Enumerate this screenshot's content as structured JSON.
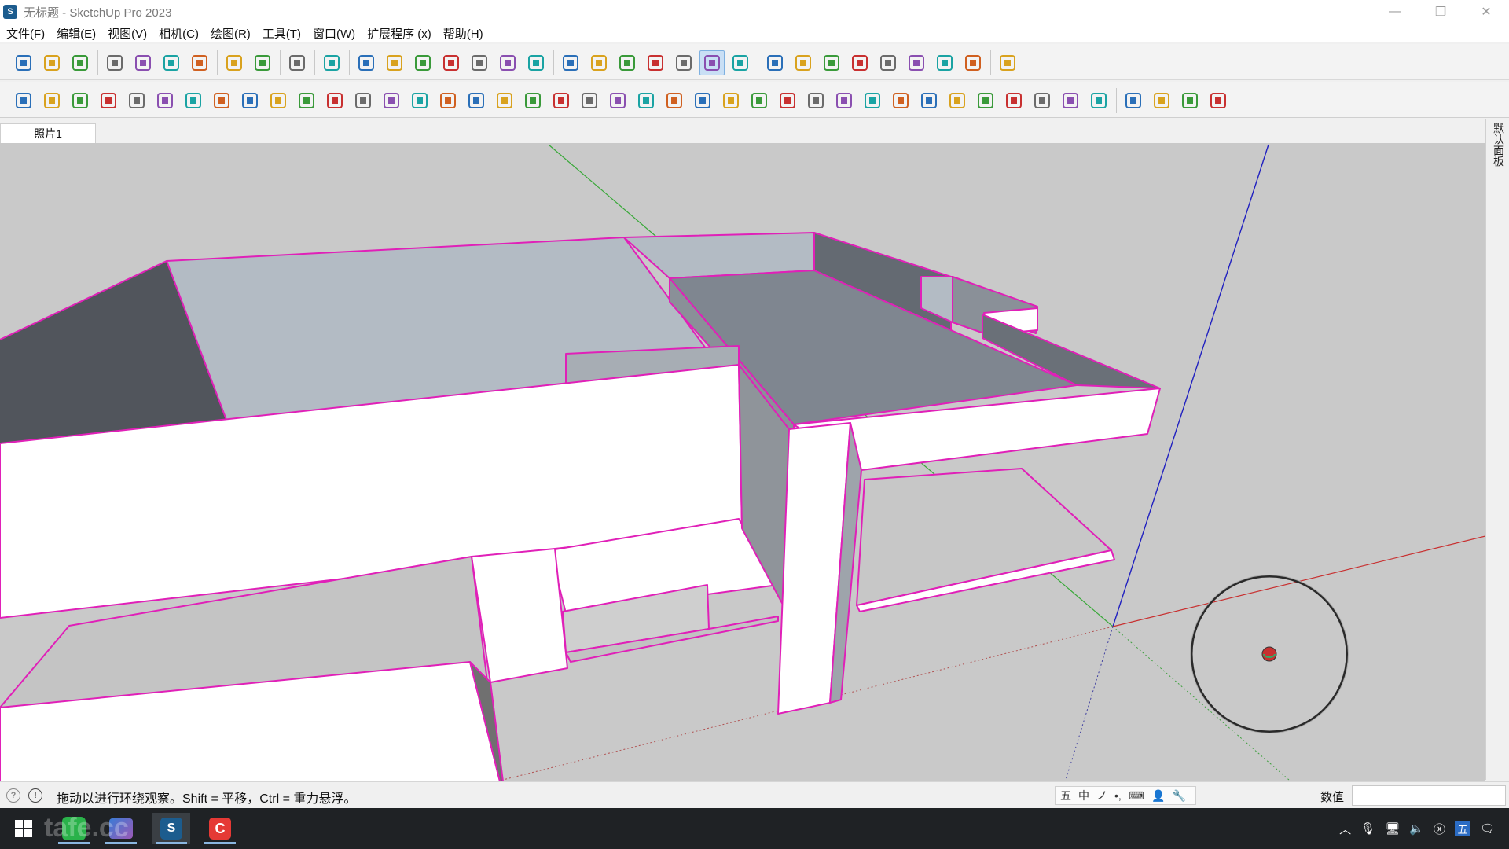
{
  "window": {
    "title": "无标题 - SketchUp Pro 2023",
    "logo": "sketchup-logo-icon",
    "controls": [
      "minimize-icon",
      "restore-icon",
      "close-icon"
    ]
  },
  "menu": [
    "文件(F)",
    "编辑(E)",
    "视图(V)",
    "相机(C)",
    "绘图(R)",
    "工具(T)",
    "窗口(W)",
    "扩展程序 (x)",
    "帮助(H)"
  ],
  "toolbar_top": [
    "new-icon",
    "open-icon",
    "save-icon",
    "|",
    "cut-icon",
    "copy-icon",
    "paste-icon",
    "erase-icon",
    "|",
    "undo-icon",
    "redo-icon",
    "|",
    "print-icon",
    "|",
    "model-info-icon",
    "|",
    "iso-view-icon",
    "top-view-icon",
    "front-view-icon",
    "right-view-icon",
    "back-view-icon",
    "left-view-icon",
    "bottom-view-icon",
    "|",
    "xray-icon",
    "back-edges-icon",
    "wireframe-icon",
    "hidden-line-icon",
    "shaded-icon",
    "shaded-textures-icon",
    "monochrome-icon",
    "|",
    "section-plane-icon",
    "axes-icon",
    "push-pull-icon",
    "move-icon",
    "tape-icon",
    "protractor-icon",
    "rotate-icon",
    "follow-me-icon",
    "|",
    "ruby-icon"
  ],
  "toolbar_top_active": "shaded-textures-icon",
  "toolbar_second": [
    "ext-box-blue-icon",
    "ext-plane-blue-icon",
    "ext-plane-yellow-icon",
    "ext-plane-green-icon",
    "ext-plane-red-icon",
    "ext-plane-white-icon",
    "ext-lathe-icon",
    "ext-red-square-icon",
    "ext-table-icon",
    "ext-flag-icon",
    "ext-box-brown-icon",
    "ext-link-icon",
    "ext-corner-icon",
    "ext-nodes-icon",
    "ext-cross-red-icon",
    "ext-cross-green-icon",
    "ext-cross-blue-icon",
    "ext-cone-icon",
    "ext-mountain-icon",
    "ext-triangle-icon",
    "ext-spiral-icon",
    "ext-twist-icon",
    "ext-rotate-icon",
    "ext-star-icon",
    "ext-cube-icon",
    "ext-arc-red-icon",
    "ext-puzzle-icon",
    "ext-cube2-icon",
    "ext-cube3-icon",
    "ext-cube4-icon",
    "ext-gem-icon",
    "ext-grid-icon",
    "ext-frame-icon",
    "ext-hatch-icon",
    "ext-window-icon",
    "ext-grid2-icon",
    "ext-scatter-icon",
    "ext-curve-icon",
    "ext-layout-icon",
    "|",
    "ext-arc-icon",
    "ext-line-icon",
    "ext-wave-icon",
    "ext-spline-icon"
  ],
  "scene_tab": "照片1",
  "right_tray_label": "默认面板",
  "viewport": {
    "background": "#c9c9c9",
    "edge_color": "#e020b8"
  },
  "status": {
    "text": "拖动以进行环绕观察。Shift = 平移，Ctrl = 重力悬浮。",
    "measure_label": "数值",
    "measure_value": ""
  },
  "ime": [
    "五",
    "中",
    "ノ",
    "•,",
    "⌨",
    "👤",
    "🔧"
  ],
  "taskbar": {
    "apps": [
      "windows-start-icon",
      "tafe-icon",
      "paint-icon",
      "sketchup-taskbar-icon",
      "red-app-icon"
    ],
    "tray": [
      "chevron-up-icon",
      "mic-icon",
      "network-icon",
      "volume-icon",
      "close-circle-icon",
      "ime-icon",
      "notification-icon"
    ],
    "tray_ime_label": "五",
    "watermark": "tafe.cc"
  }
}
